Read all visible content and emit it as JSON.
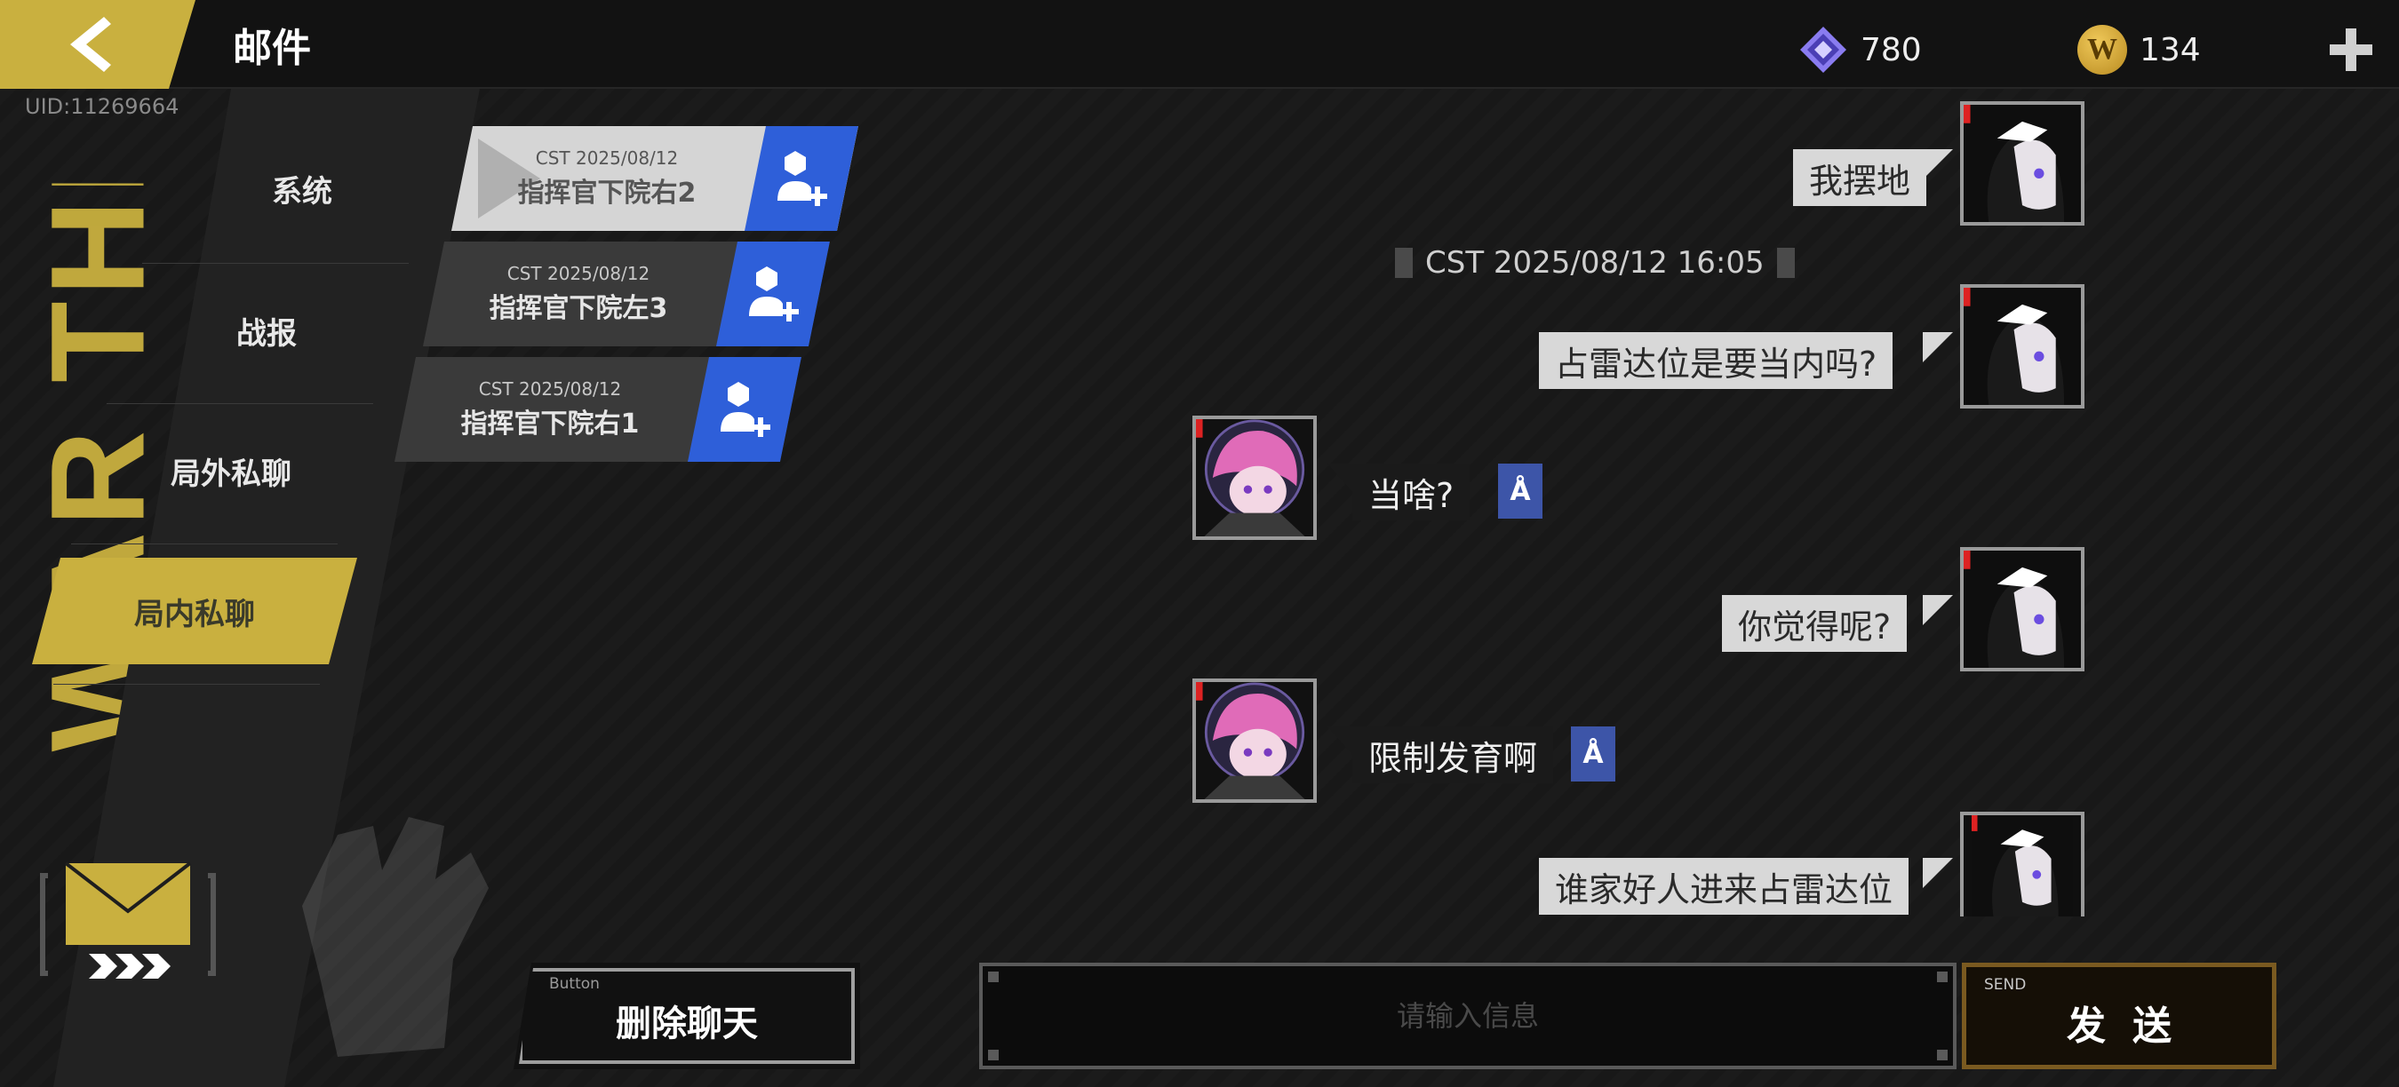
{
  "header": {
    "title": "邮件",
    "uid": "UID:11269664",
    "gems": "780",
    "coins": "134",
    "coin_symbol": "W"
  },
  "decor": {
    "vertical_text": "WAR THE WAR"
  },
  "categories": [
    {
      "label": "系统",
      "active": false
    },
    {
      "label": "战报",
      "active": false
    },
    {
      "label": "局外私聊",
      "active": false
    },
    {
      "label": "局内私聊",
      "active": true
    }
  ],
  "conversations": [
    {
      "date": "CST 2025/08/12",
      "name": "指挥官下院右2",
      "active": true
    },
    {
      "date": "CST 2025/08/12",
      "name": "指挥官下院左3",
      "active": false
    },
    {
      "date": "CST 2025/08/12",
      "name": "指挥官下院右1",
      "active": false
    }
  ],
  "chat": {
    "timestamp": "CST 2025/08/12 16:05",
    "translate_glyph": "Å",
    "messages": [
      {
        "from": "me",
        "text": "我摆地"
      },
      {
        "from": "me",
        "text": "占雷达位是要当内吗?"
      },
      {
        "from": "them",
        "text": "当啥?"
      },
      {
        "from": "me",
        "text": "你觉得呢?"
      },
      {
        "from": "them",
        "text": "限制发育啊"
      },
      {
        "from": "me",
        "text": "谁家好人进来占雷达位"
      }
    ]
  },
  "footer": {
    "delete_small": "Button",
    "delete_label": "删除聊天",
    "input_placeholder": "请输入信息",
    "send_small": "SEND",
    "send_label": "发送"
  },
  "colors": {
    "accent_gold": "#c9b03f",
    "accent_blue": "#2e5fd9",
    "translate_blue": "#3d55a8"
  }
}
